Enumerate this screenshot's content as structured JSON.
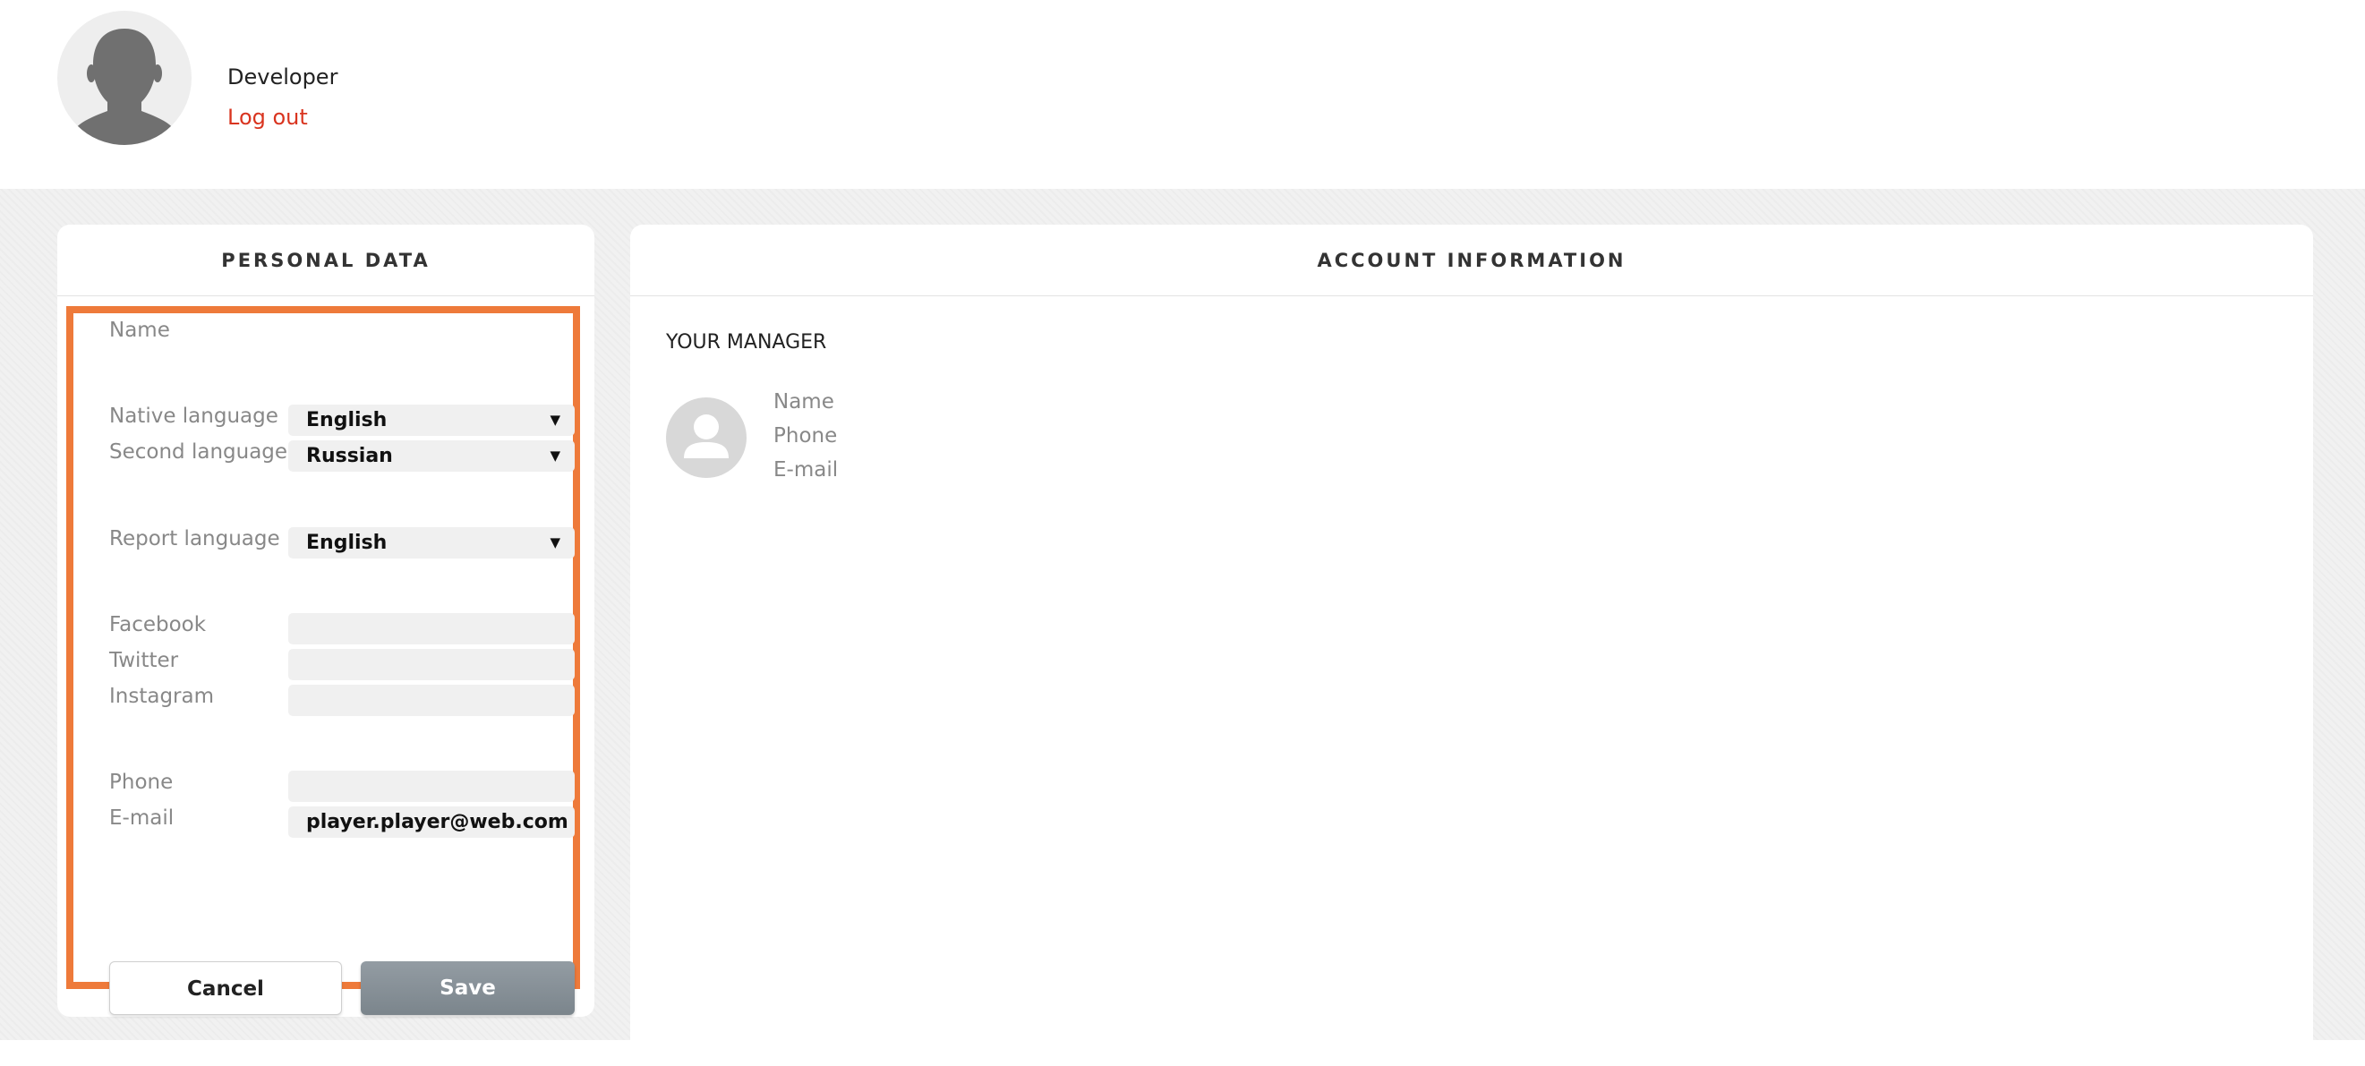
{
  "header": {
    "user_name": "Developer",
    "logout_label": "Log out"
  },
  "personal_data": {
    "title": "PERSONAL DATA",
    "name_label": "Name",
    "native_language_label": "Native language",
    "native_language_value": "English",
    "second_language_label": "Second language",
    "second_language_value": "Russian",
    "report_language_label": "Report language",
    "report_language_value": "English",
    "facebook_label": "Facebook",
    "facebook_value": "",
    "twitter_label": "Twitter",
    "twitter_value": "",
    "instagram_label": "Instagram",
    "instagram_value": "",
    "phone_label": "Phone",
    "phone_value": "",
    "email_label": "E-mail",
    "email_value": "player.player@web.com",
    "cancel_label": "Cancel",
    "save_label": "Save",
    "dropdown_arrow": "▼"
  },
  "account_information": {
    "title": "ACCOUNT INFORMATION",
    "manager_title": "YOUR MANAGER",
    "manager_name_label": "Name",
    "manager_phone_label": "Phone",
    "manager_email_label": "E-mail"
  },
  "icons": {
    "user_avatar": "user-silhouette-icon",
    "manager_avatar": "person-icon"
  },
  "colors": {
    "logout": "#d9341f",
    "highlight_border": "#ee7a3a",
    "save_button": "#868f96",
    "page_background": "#f1f1f1"
  }
}
